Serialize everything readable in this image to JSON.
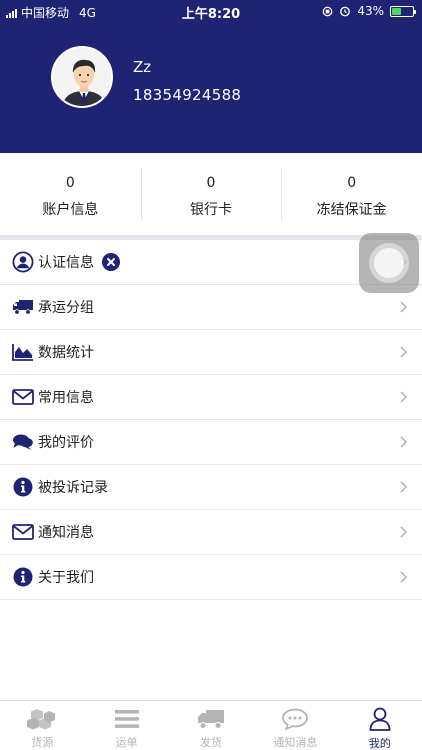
{
  "status_bar": {
    "carrier": "中国移动",
    "network": "4G",
    "time": "上午8:20",
    "battery": "43%",
    "battery_level": 0.43
  },
  "profile": {
    "name": "Zz",
    "phone": "18354924588"
  },
  "stats": [
    {
      "value": "0",
      "label": "账户信息"
    },
    {
      "value": "0",
      "label": "银行卡"
    },
    {
      "value": "0",
      "label": "冻结保证金"
    }
  ],
  "menu": [
    {
      "label": "认证信息",
      "icon": "user-circle-icon"
    },
    {
      "label": "承运分组",
      "icon": "truck-icon"
    },
    {
      "label": "数据统计",
      "icon": "area-chart-icon"
    },
    {
      "label": "常用信息",
      "icon": "envelope-icon"
    },
    {
      "label": "我的评价",
      "icon": "comments-icon"
    },
    {
      "label": "被投诉记录",
      "icon": "info-icon"
    },
    {
      "label": "通知消息",
      "icon": "envelope-icon"
    },
    {
      "label": "关于我们",
      "icon": "info-icon"
    }
  ],
  "tabs": [
    {
      "label": "货源",
      "icon": "cubes-icon",
      "active": false
    },
    {
      "label": "运单",
      "icon": "list-icon",
      "active": false
    },
    {
      "label": "发货",
      "icon": "truck-icon",
      "active": false
    },
    {
      "label": "通知消息",
      "icon": "chat-bubble-icon",
      "active": false
    },
    {
      "label": "我的",
      "icon": "user-icon",
      "active": true
    }
  ],
  "colors": {
    "primary": "#1e2473",
    "tab_inactive": "#b4b4b4",
    "divider": "#e8e8e8"
  }
}
